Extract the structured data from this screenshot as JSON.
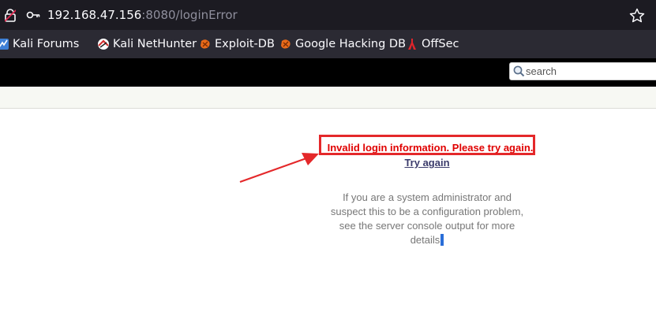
{
  "browser": {
    "url_host": "192.168.47.156",
    "url_rest": ":8080/loginError"
  },
  "bookmarks": [
    {
      "label": "Kali Forums",
      "icon": "kali-forums-icon"
    },
    {
      "label": "Kali NetHunter",
      "icon": "kali-nethunter-icon"
    },
    {
      "label": "Exploit-DB",
      "icon": "exploit-db-icon"
    },
    {
      "label": "Google Hacking DB",
      "icon": "google-hacking-db-icon"
    },
    {
      "label": "OffSec",
      "icon": "offsec-icon"
    }
  ],
  "header": {
    "search_placeholder": "search"
  },
  "main": {
    "error_message": "Invalid login information. Please try again.",
    "try_again_link": "Try again",
    "help_lines": [
      "If you are a system administrator and",
      "suspect this to be a configuration problem,",
      "see the server console output for more",
      "details"
    ]
  },
  "colors": {
    "error": "#e00000",
    "annotation": "#e4282a",
    "link": "#3b3b6b"
  }
}
